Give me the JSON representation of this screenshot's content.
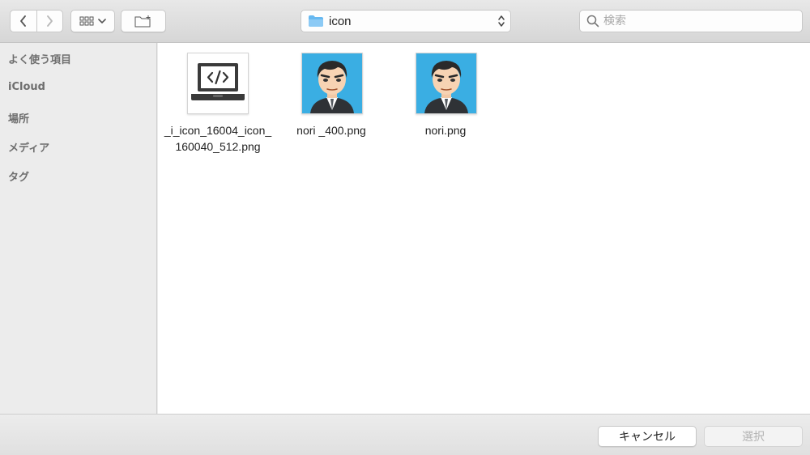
{
  "toolbar": {
    "path_popup": {
      "label": "icon"
    },
    "search": {
      "placeholder": "検索",
      "value": ""
    }
  },
  "sidebar": {
    "items": [
      {
        "label": "よく使う項目"
      },
      {
        "label": "iCloud"
      },
      {
        "label": "場所"
      },
      {
        "label": "メディア"
      },
      {
        "label": "タグ"
      }
    ]
  },
  "files": [
    {
      "name": "_i_icon_16004_icon_160040_512.png",
      "thumbnail": "laptop-code-icon"
    },
    {
      "name": "nori _400.png",
      "thumbnail": "avatar-portrait"
    },
    {
      "name": "nori.png",
      "thumbnail": "avatar-portrait"
    }
  ],
  "footer": {
    "cancel_label": "キャンセル",
    "select_label": "選択"
  },
  "colors": {
    "folder_blue": "#66b8f0",
    "avatar_bg": "#3aaee3",
    "disabled_text": "#b3b3b3"
  }
}
